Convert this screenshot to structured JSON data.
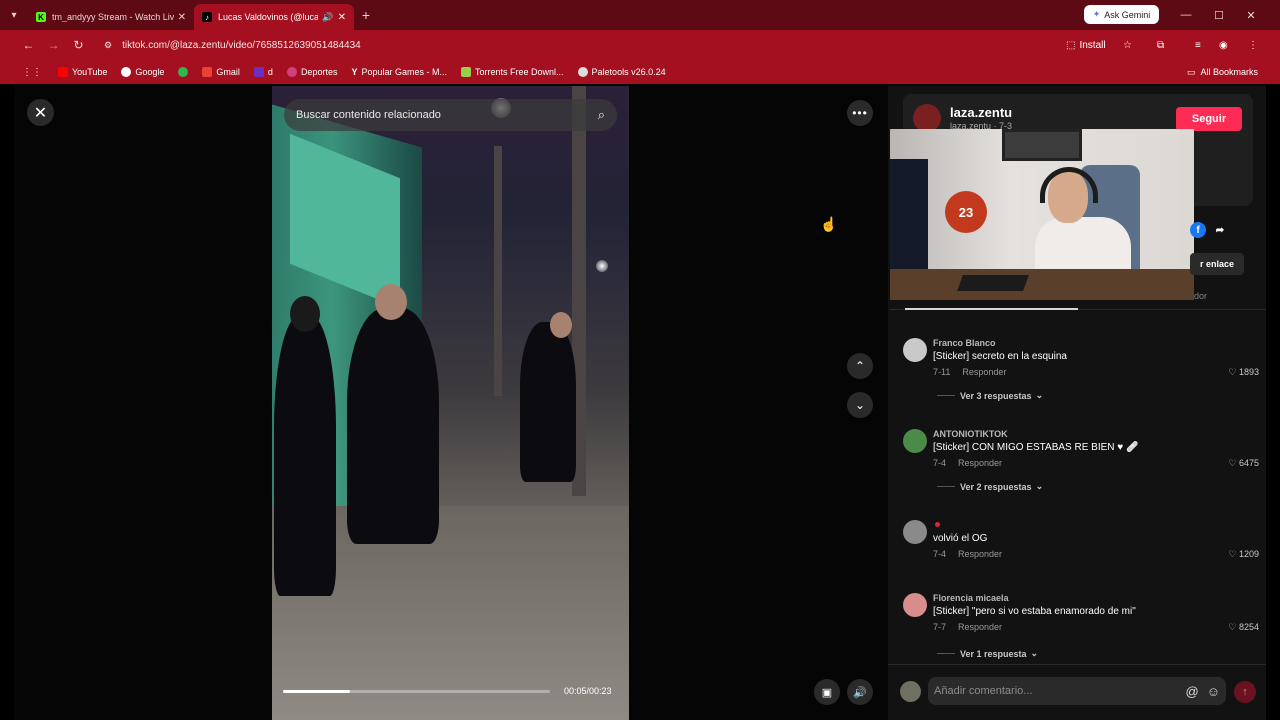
{
  "browser": {
    "tabs": [
      {
        "title": "tm_andyyy Stream - Watch Live",
        "active": false
      },
      {
        "title": "Lucas Valdovinos (@lucasv...",
        "active": true
      }
    ],
    "ask_gemini": "Ask Gemini",
    "url": "tiktok.com/@laza.zentu/video/7658512639051484434",
    "install": "Install",
    "bookmarks": [
      "YouTube",
      "Google",
      "Gmail",
      "d",
      "Deportes",
      "Popular Games - M...",
      "Torrents Free Downl...",
      "Paletools v26.0.24"
    ],
    "all_bookmarks": "All Bookmarks"
  },
  "video": {
    "search_placeholder": "Buscar contenido relacionado",
    "time": "00:05/00:23",
    "progress": 0.25
  },
  "author": {
    "name": "laza.zentu",
    "sub": "laza.zentu · 7-3",
    "follow": "Seguir",
    "copy_link": "r enlace",
    "truncated": "dor"
  },
  "webcam": {
    "ball_number": "23"
  },
  "comments": [
    {
      "user": "Franco Blanco",
      "text": "[Sticker] secreto en la esquina",
      "date": "7-11",
      "reply": "Responder",
      "likes": "1893",
      "replies": "Ver 3 respuestas"
    },
    {
      "user": "ANTONIOTIKTOK",
      "text": "[Sticker] CON MIGO ESTABAS RE BIEN ♥ 🩹",
      "date": "7-4",
      "reply": "Responder",
      "likes": "6475",
      "replies": "Ver 2 respuestas"
    },
    {
      "user": "",
      "text": "volvió el OG",
      "date": "7-4",
      "reply": "Responder",
      "likes": "1209",
      "replies": ""
    },
    {
      "user": "Florencia micaela",
      "text": "[Sticker] \"pero si vo estaba enamorado de mi\"",
      "date": "7-7",
      "reply": "Responder",
      "likes": "8254",
      "replies": "Ver 1 respuesta"
    }
  ],
  "comment_input": {
    "placeholder": "Añadir comentario..."
  },
  "colors": {
    "titlebar": "#5d0a14",
    "toolbar": "#a4101f",
    "accent": "#fe2c55"
  }
}
